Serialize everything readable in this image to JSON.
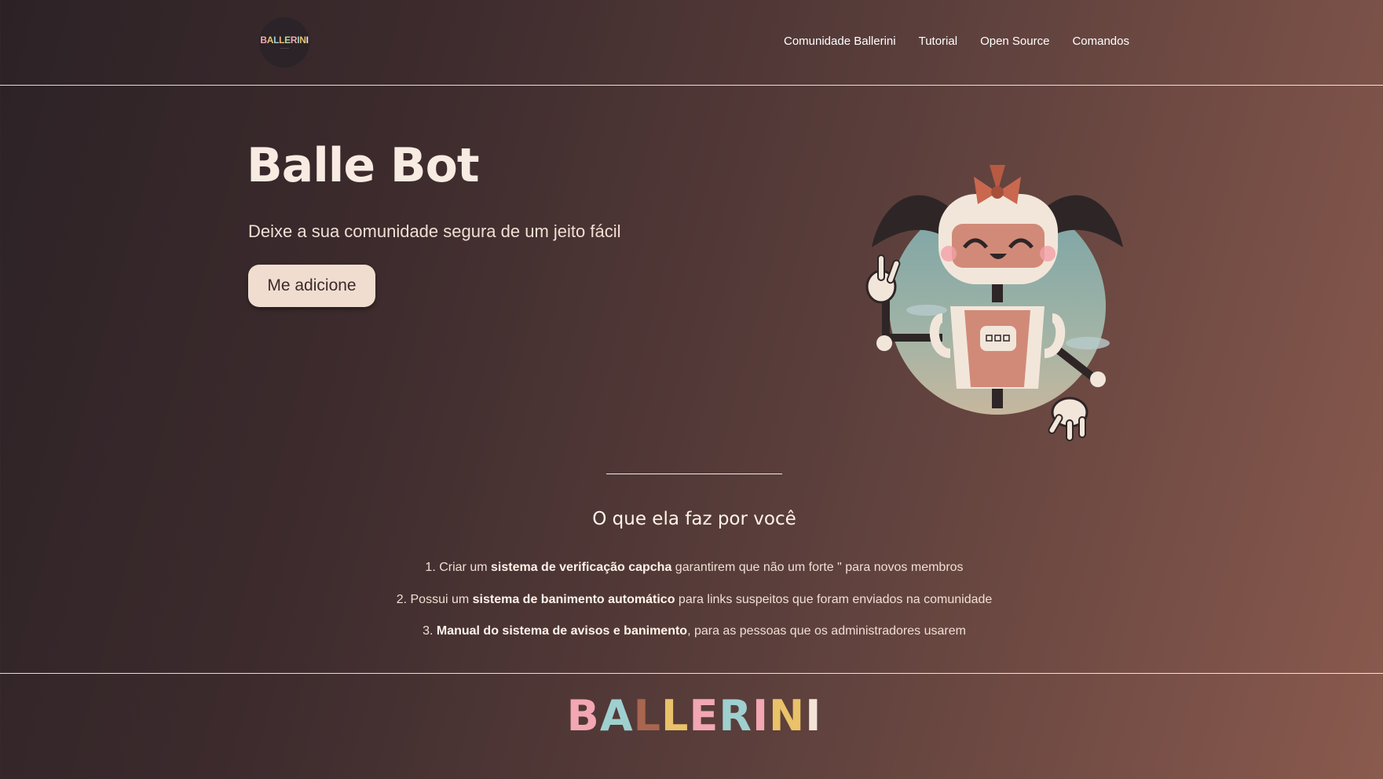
{
  "header": {
    "logo_text": "BALLERINI",
    "nav": [
      {
        "label": "Comunidade Ballerini"
      },
      {
        "label": "Tutorial"
      },
      {
        "label": "Open Source"
      },
      {
        "label": "Comandos"
      }
    ]
  },
  "hero": {
    "title": "Balle Bot",
    "subtitle": "Deixe a sua comunidade segura de um jeito fácil",
    "cta_label": "Me adicione",
    "illustration_icon": "robot-girl-icon"
  },
  "features": {
    "title": "O que ela faz por você",
    "items": [
      {
        "prefix": "1. Criar um ",
        "bold": "sistema de verificação capcha",
        "suffix": " garantirem que não um forte \" para novos membros"
      },
      {
        "prefix": "2. Possui um ",
        "bold": "sistema de banimento automático",
        "suffix": " para links suspeitos que foram enviados na comunidade"
      },
      {
        "prefix": "3. ",
        "bold": "Manual do sistema de avisos e banimento",
        "suffix": ", para as pessoas que os administradores usarem"
      }
    ]
  },
  "footer": {
    "brand": "BALLERINI"
  },
  "colors": {
    "background_start": "#2c2226",
    "background_end": "#8a5a4e",
    "button_bg": "#f0ddd0",
    "text_light": "#f3e4d8"
  }
}
